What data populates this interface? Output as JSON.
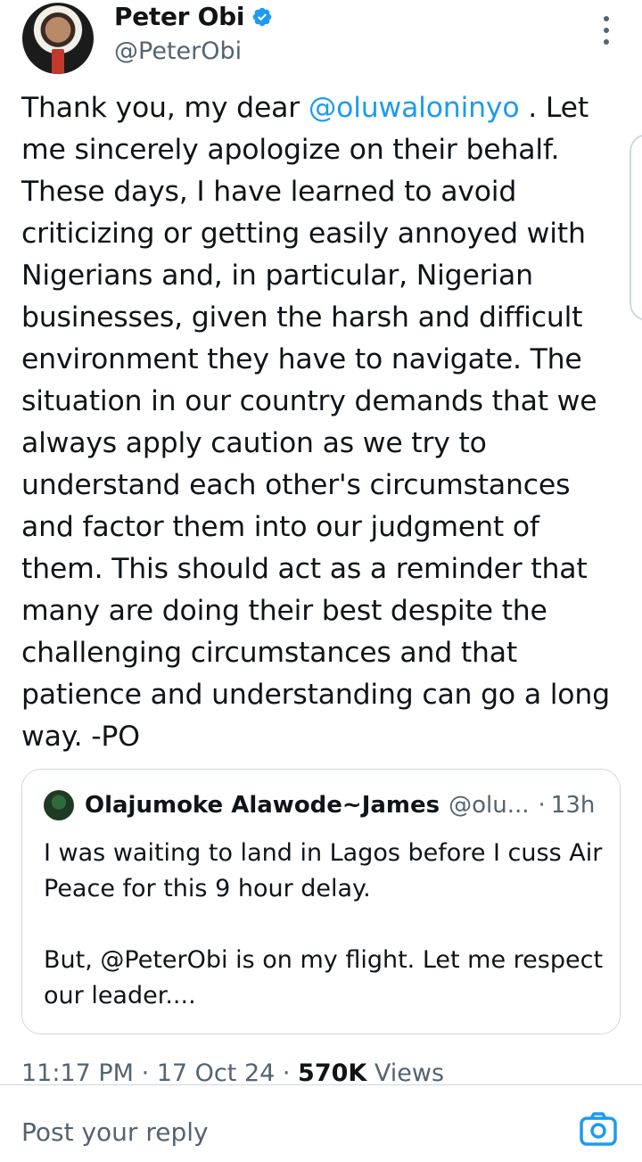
{
  "author": {
    "name": "Peter Obi",
    "handle": "@PeterObi"
  },
  "tweet": {
    "text_before_mention": "Thank you, my dear ",
    "mention": "@oluwaloninyo",
    "text_after_mention": " . Let me sincerely apologize on their behalf. These days, I have learned to avoid criticizing or getting easily annoyed with Nigerians and, in particular, Nigerian businesses, given the harsh and difficult environment they have to navigate. The situation in our country demands that we always apply caution as we try to understand each other's circumstances and factor them into our judgment of them. This should act as a reminder that many are doing their best despite the challenging circumstances and that patience and understanding can go a long way. -PO"
  },
  "quoted_tweet": {
    "name": "Olajumoke Alawode~James",
    "handle": "@olu...",
    "separator": "·",
    "time": "13h",
    "line1": "I was waiting to land in Lagos before I cuss Air Peace for this 9 hour delay.",
    "line2": "But, @PeterObi is on my flight. Let me respect our leader...."
  },
  "meta": {
    "time": "11:17 PM",
    "sep1": " · ",
    "date": "17 Oct 24",
    "sep2": " · ",
    "views_count": "570K",
    "views_label": " Views"
  },
  "reply": {
    "placeholder": "Post your reply"
  },
  "icons": {
    "verified": "verified-badge-icon",
    "more": "more-options-icon",
    "camera": "camera-icon"
  },
  "colors": {
    "accent": "#1d9bf0",
    "text": "#0f1419",
    "secondary": "#536471",
    "border": "#cfd9de"
  }
}
